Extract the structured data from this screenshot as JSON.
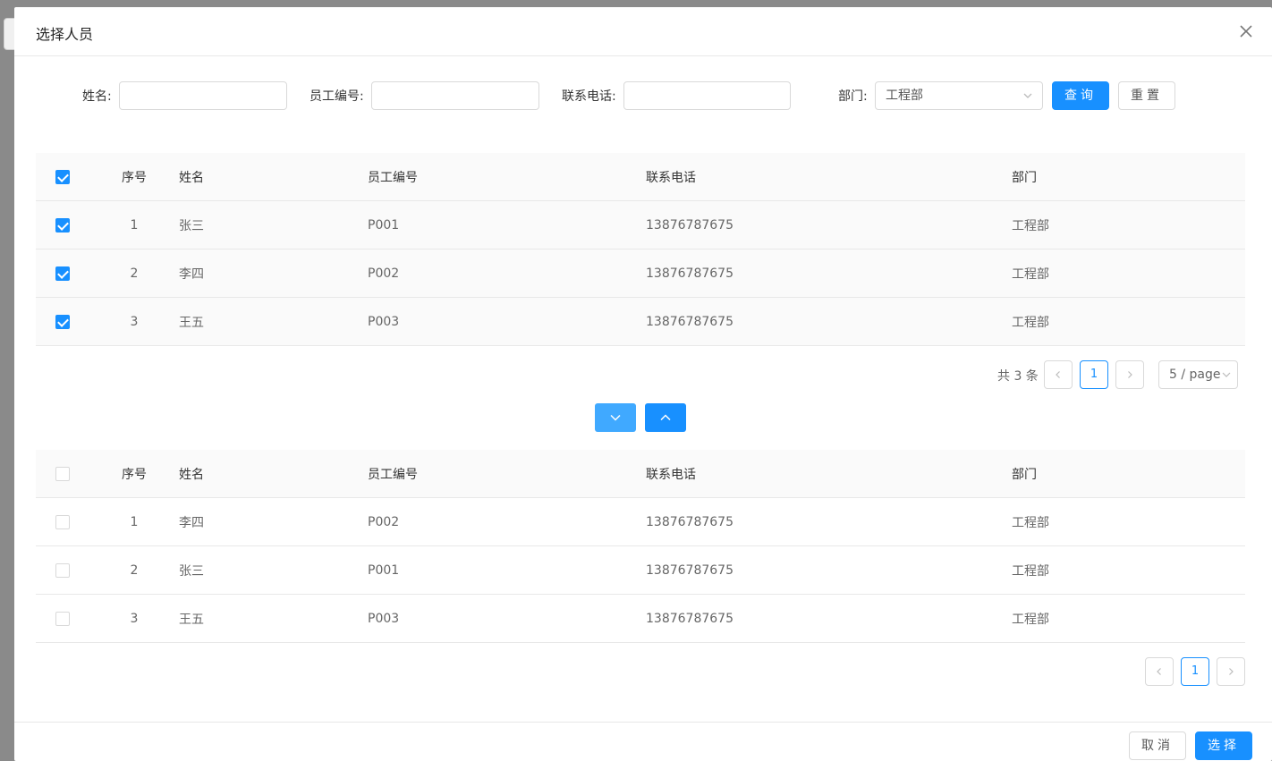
{
  "dialog": {
    "title": "选择人员"
  },
  "filters": {
    "name_label": "姓名:",
    "code_label": "员工编号:",
    "phone_label": "联系电话:",
    "dept_label": "部门:",
    "name_value": "",
    "code_value": "",
    "phone_value": "",
    "dept_value": "工程部",
    "search_label": "查询",
    "reset_label": "重置"
  },
  "columns": [
    "序号",
    "姓名",
    "员工编号",
    "联系电话",
    "部门"
  ],
  "top_table": {
    "header_checked": true,
    "rows": [
      {
        "checked": true,
        "idx": "1",
        "name": "张三",
        "code": "P001",
        "phone": "13876787675",
        "dept": "工程部"
      },
      {
        "checked": true,
        "idx": "2",
        "name": "李四",
        "code": "P002",
        "phone": "13876787675",
        "dept": "工程部"
      },
      {
        "checked": true,
        "idx": "3",
        "name": "王五",
        "code": "P003",
        "phone": "13876787675",
        "dept": "工程部"
      }
    ],
    "pager": {
      "total": "共 3 条",
      "page": "1",
      "page_size": "5 / page"
    }
  },
  "bottom_table": {
    "header_checked": false,
    "rows": [
      {
        "checked": false,
        "idx": "1",
        "name": "李四",
        "code": "P002",
        "phone": "13876787675",
        "dept": "工程部"
      },
      {
        "checked": false,
        "idx": "2",
        "name": "张三",
        "code": "P001",
        "phone": "13876787675",
        "dept": "工程部"
      },
      {
        "checked": false,
        "idx": "3",
        "name": "王五",
        "code": "P003",
        "phone": "13876787675",
        "dept": "工程部"
      }
    ],
    "pager": {
      "page": "1"
    }
  },
  "footer": {
    "cancel_label": "取消",
    "confirm_label": "选择"
  },
  "colors": {
    "primary": "#1890ff",
    "primary_light": "#40a9ff",
    "border": "#d9d9d9",
    "header_bg": "#fafafa"
  },
  "icons": {
    "close": "close-icon",
    "select_arrow": "chevron-down-icon",
    "move_down": "chevron-down-icon",
    "move_up": "chevron-up-icon",
    "prev": "chevron-left-icon",
    "next": "chevron-right-icon"
  }
}
